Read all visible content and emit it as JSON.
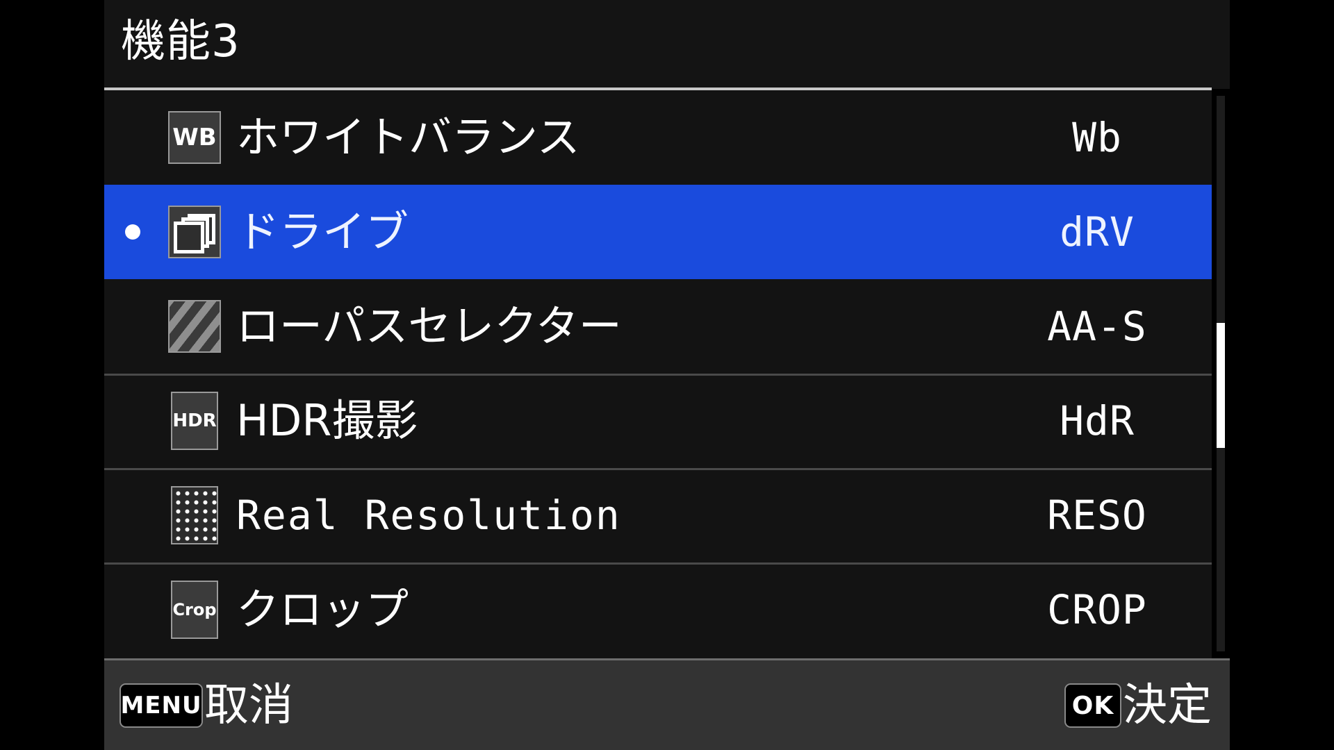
{
  "screen": {
    "background_color": "#000000",
    "panel_background": "#131313",
    "highlight_color": "#1A4BDD",
    "text_color": "#FFFFFF",
    "separator_color": "#4A4A4A",
    "footer_background": "#333333"
  },
  "header": {
    "title": "機能3"
  },
  "menu": {
    "selected_index": 1,
    "rows": [
      {
        "icon_name": "white-balance-icon",
        "icon_text": "WB",
        "label": "ホワイトバランス",
        "abbr": "Wb",
        "selected": false,
        "bullet": false,
        "label_style": "jp"
      },
      {
        "icon_name": "drive-mode-icon",
        "icon_text": "",
        "label": "ドライブ",
        "abbr": "dRV",
        "selected": true,
        "bullet": true,
        "label_style": "jp"
      },
      {
        "icon_name": "low-pass-filter-icon",
        "icon_text": "",
        "label": "ローパスセレクター",
        "abbr": "AA-S",
        "selected": false,
        "bullet": false,
        "label_style": "jp"
      },
      {
        "icon_name": "hdr-icon",
        "icon_text": "HDR",
        "label": "HDR撮影",
        "abbr": "HdR",
        "selected": false,
        "bullet": false,
        "label_style": "jp"
      },
      {
        "icon_name": "real-resolution-icon",
        "icon_text": "",
        "label": "Real Resolution",
        "abbr": "RESO",
        "selected": false,
        "bullet": false,
        "label_style": "mono"
      },
      {
        "icon_name": "crop-icon",
        "icon_text": "Crop",
        "label": "クロップ",
        "abbr": "CROP",
        "selected": false,
        "bullet": false,
        "label_style": "jp"
      }
    ]
  },
  "scrollbar": {
    "thumb_position_pct": 41,
    "thumb_size_pct": 22
  },
  "footer": {
    "cancel_key": "MENU",
    "cancel_label": "取消",
    "confirm_key": "OK",
    "confirm_label": "決定"
  }
}
